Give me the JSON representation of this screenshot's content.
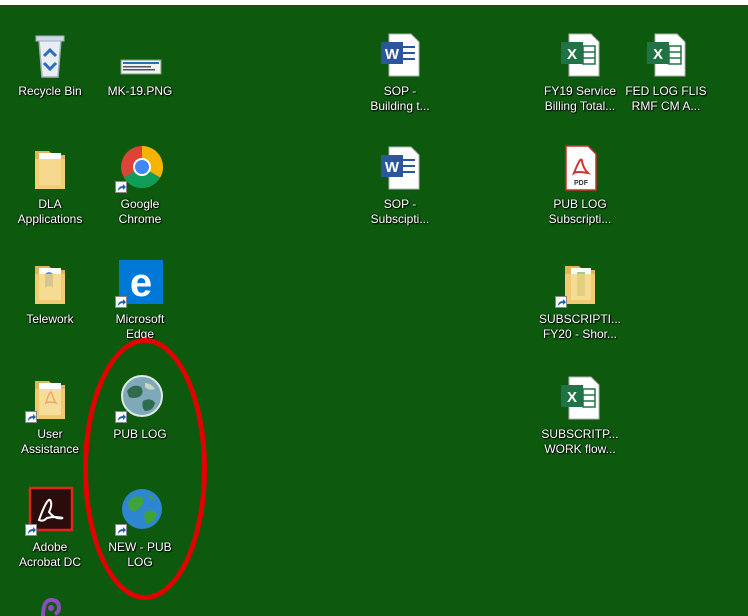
{
  "desktop": {
    "icons": [
      {
        "label": "Recycle Bin",
        "icon": "recycle-bin-icon",
        "shortcut": false
      },
      {
        "label": "MK-19.PNG",
        "icon": "image-file-icon",
        "shortcut": false
      },
      {
        "label": "SOP -\nBuilding t...",
        "icon": "word-document-icon",
        "shortcut": false
      },
      {
        "label": "FY19 Service\nBilling Total...",
        "icon": "excel-document-icon",
        "shortcut": false
      },
      {
        "label": "FED LOG FLIS\nRMF CM A...",
        "icon": "excel-document-icon",
        "shortcut": false
      },
      {
        "label": "DLA\nApplications",
        "icon": "folder-icon",
        "shortcut": false
      },
      {
        "label": "Google\nChrome",
        "icon": "chrome-icon",
        "shortcut": true
      },
      {
        "label": "SOP -\nSubscipti...",
        "icon": "word-document-icon",
        "shortcut": false
      },
      {
        "label": "PUB LOG\nSubscripti...",
        "icon": "pdf-document-icon",
        "shortcut": false
      },
      {
        "label": "Telework",
        "icon": "folder-icon",
        "shortcut": false
      },
      {
        "label": "Microsoft\nEdge",
        "icon": "edge-icon",
        "shortcut": true
      },
      {
        "label": "SUBSCRIPTI...\nFY20 - Shor...",
        "icon": "folder-icon",
        "shortcut": true
      },
      {
        "label": "User\nAssistance",
        "icon": "folder-icon",
        "shortcut": true
      },
      {
        "label": "PUB LOG",
        "icon": "pub-log-globe-icon",
        "shortcut": true
      },
      {
        "label": "SUBSCRITP...\nWORK flow...",
        "icon": "excel-document-icon",
        "shortcut": false
      },
      {
        "label": "Adobe\nAcrobat DC",
        "icon": "acrobat-icon",
        "shortcut": true
      },
      {
        "label": "NEW - PUB\nLOG",
        "icon": "globe-icon",
        "shortcut": true
      }
    ]
  },
  "colors": {
    "desktop_background": "#0d5a0f",
    "highlight_circle": "#e50000"
  }
}
